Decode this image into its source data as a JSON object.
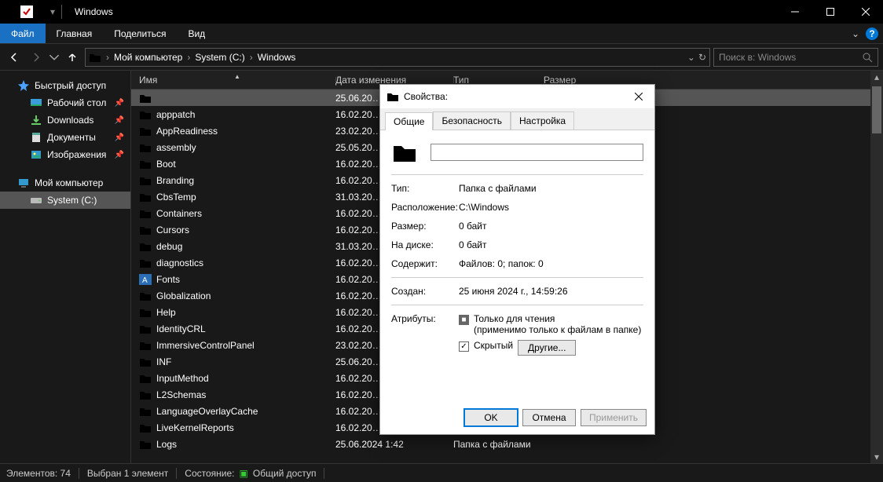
{
  "titlebar": {
    "title": "Windows"
  },
  "wincontrols": {
    "min": "—",
    "max": "☐",
    "close": "✕"
  },
  "ribbon": {
    "file": "Файл",
    "tabs": [
      "Главная",
      "Поделиться",
      "Вид"
    ]
  },
  "breadcrumb": [
    "Мой компьютер",
    "System (C:)",
    "Windows"
  ],
  "search": {
    "placeholder": "Поиск в: Windows"
  },
  "sidebar": {
    "quick": "Быстрый доступ",
    "desktop": "Рабочий стол",
    "downloads": "Downloads",
    "documents": "Документы",
    "pictures": "Изображения",
    "mypc": "Мой компьютер",
    "systemc": "System (C:)"
  },
  "columns": {
    "name": "Имя",
    "date": "Дата изменения",
    "type": "Тип",
    "size": "Размер"
  },
  "files": [
    {
      "name": "",
      "date": "25.06.20…",
      "selected": true
    },
    {
      "name": "apppatch",
      "date": "16.02.20…"
    },
    {
      "name": "AppReadiness",
      "date": "23.02.20…"
    },
    {
      "name": "assembly",
      "date": "25.05.20…"
    },
    {
      "name": "Boot",
      "date": "16.02.20…"
    },
    {
      "name": "Branding",
      "date": "16.02.20…"
    },
    {
      "name": "CbsTemp",
      "date": "31.03.20…"
    },
    {
      "name": "Containers",
      "date": "16.02.20…"
    },
    {
      "name": "Cursors",
      "date": "16.02.20…"
    },
    {
      "name": "debug",
      "date": "31.03.20…"
    },
    {
      "name": "diagnostics",
      "date": "16.02.20…"
    },
    {
      "name": "Fonts",
      "date": "16.02.20…",
      "fonts": true
    },
    {
      "name": "Globalization",
      "date": "16.02.20…"
    },
    {
      "name": "Help",
      "date": "16.02.20…"
    },
    {
      "name": "IdentityCRL",
      "date": "16.02.20…"
    },
    {
      "name": "ImmersiveControlPanel",
      "date": "23.02.20…"
    },
    {
      "name": "INF",
      "date": "25.06.20…"
    },
    {
      "name": "InputMethod",
      "date": "16.02.20…"
    },
    {
      "name": "L2Schemas",
      "date": "16.02.20…"
    },
    {
      "name": "LanguageOverlayCache",
      "date": "16.02.20…"
    },
    {
      "name": "LiveKernelReports",
      "date": "16.02.20…"
    },
    {
      "name": "Logs",
      "date": "25.06.2024 1:42",
      "type": "Папка с файлами"
    }
  ],
  "statusbar": {
    "elements": "Элементов: 74",
    "selected": "Выбран 1 элемент",
    "state_label": "Состояние:",
    "share": "Общий доступ"
  },
  "dialog": {
    "title": "Свойства:",
    "tabs": [
      "Общие",
      "Безопасность",
      "Настройка"
    ],
    "name_value": "",
    "type_l": "Тип:",
    "type_v": "Папка с файлами",
    "loc_l": "Расположение:",
    "loc_v": "C:\\Windows",
    "size_l": "Размер:",
    "size_v": "0 байт",
    "disk_l": "На диске:",
    "disk_v": "0 байт",
    "cont_l": "Содержит:",
    "cont_v": "Файлов: 0; папок: 0",
    "created_l": "Создан:",
    "created_v": "25 июня 2024 г., 14:59:26",
    "attr_l": "Атрибуты:",
    "readonly_l": "Только для чтения",
    "readonly_sub": "(применимо только к файлам в папке)",
    "hidden_l": "Скрытый",
    "other_btn": "Другие...",
    "ok": "OK",
    "cancel": "Отмена",
    "apply": "Применить"
  }
}
